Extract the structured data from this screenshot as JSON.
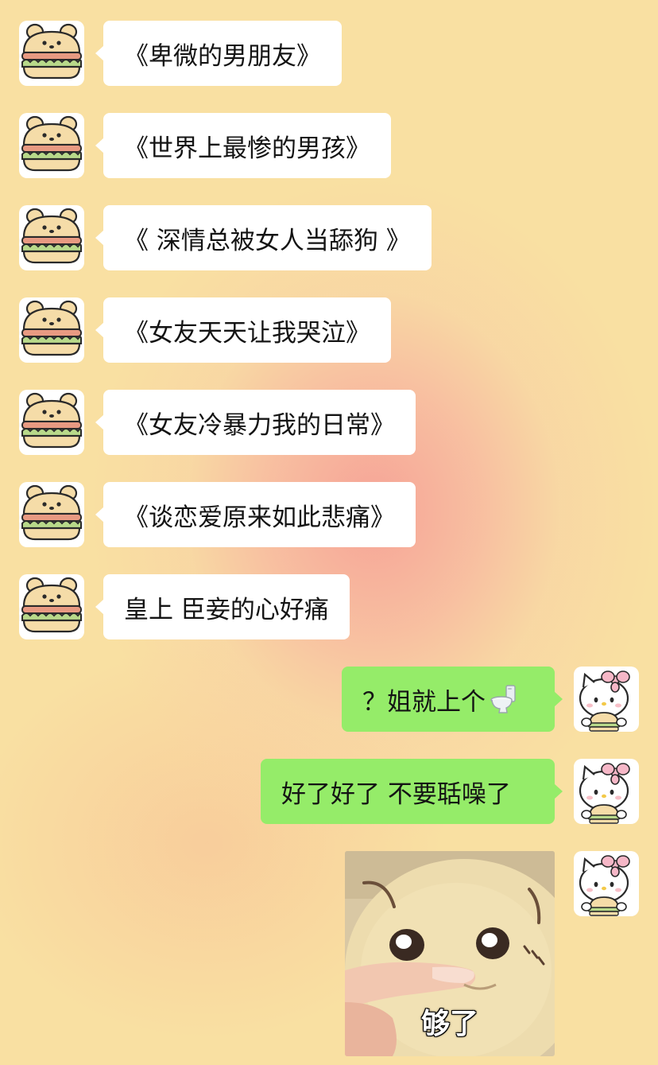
{
  "chat": {
    "left_avatar_icon": "burger-bear-avatar",
    "right_avatar_icon": "hello-kitty-avatar",
    "messages": [
      {
        "side": "left",
        "text": "《卑微的男朋友》"
      },
      {
        "side": "left",
        "text": "《世界上最惨的男孩》"
      },
      {
        "side": "left",
        "text": "《 深情总被女人当舔狗 》"
      },
      {
        "side": "left",
        "text": "《女友天天让我哭泣》"
      },
      {
        "side": "left",
        "text": "《女友冷暴力我的日常》"
      },
      {
        "side": "left",
        "text": "《谈恋爱原来如此悲痛》"
      },
      {
        "side": "left",
        "text": "皇上 臣妾的心好痛"
      },
      {
        "side": "right",
        "text": "？姐就上个",
        "emoji": "toilet-icon"
      },
      {
        "side": "right",
        "text": "好了好了 不要聒噪了"
      },
      {
        "side": "right",
        "type": "sticker",
        "caption": "够了"
      }
    ]
  },
  "colors": {
    "sent_bubble": "#95ec69",
    "received_bubble": "#ffffff",
    "background": "#f9e0a2"
  }
}
